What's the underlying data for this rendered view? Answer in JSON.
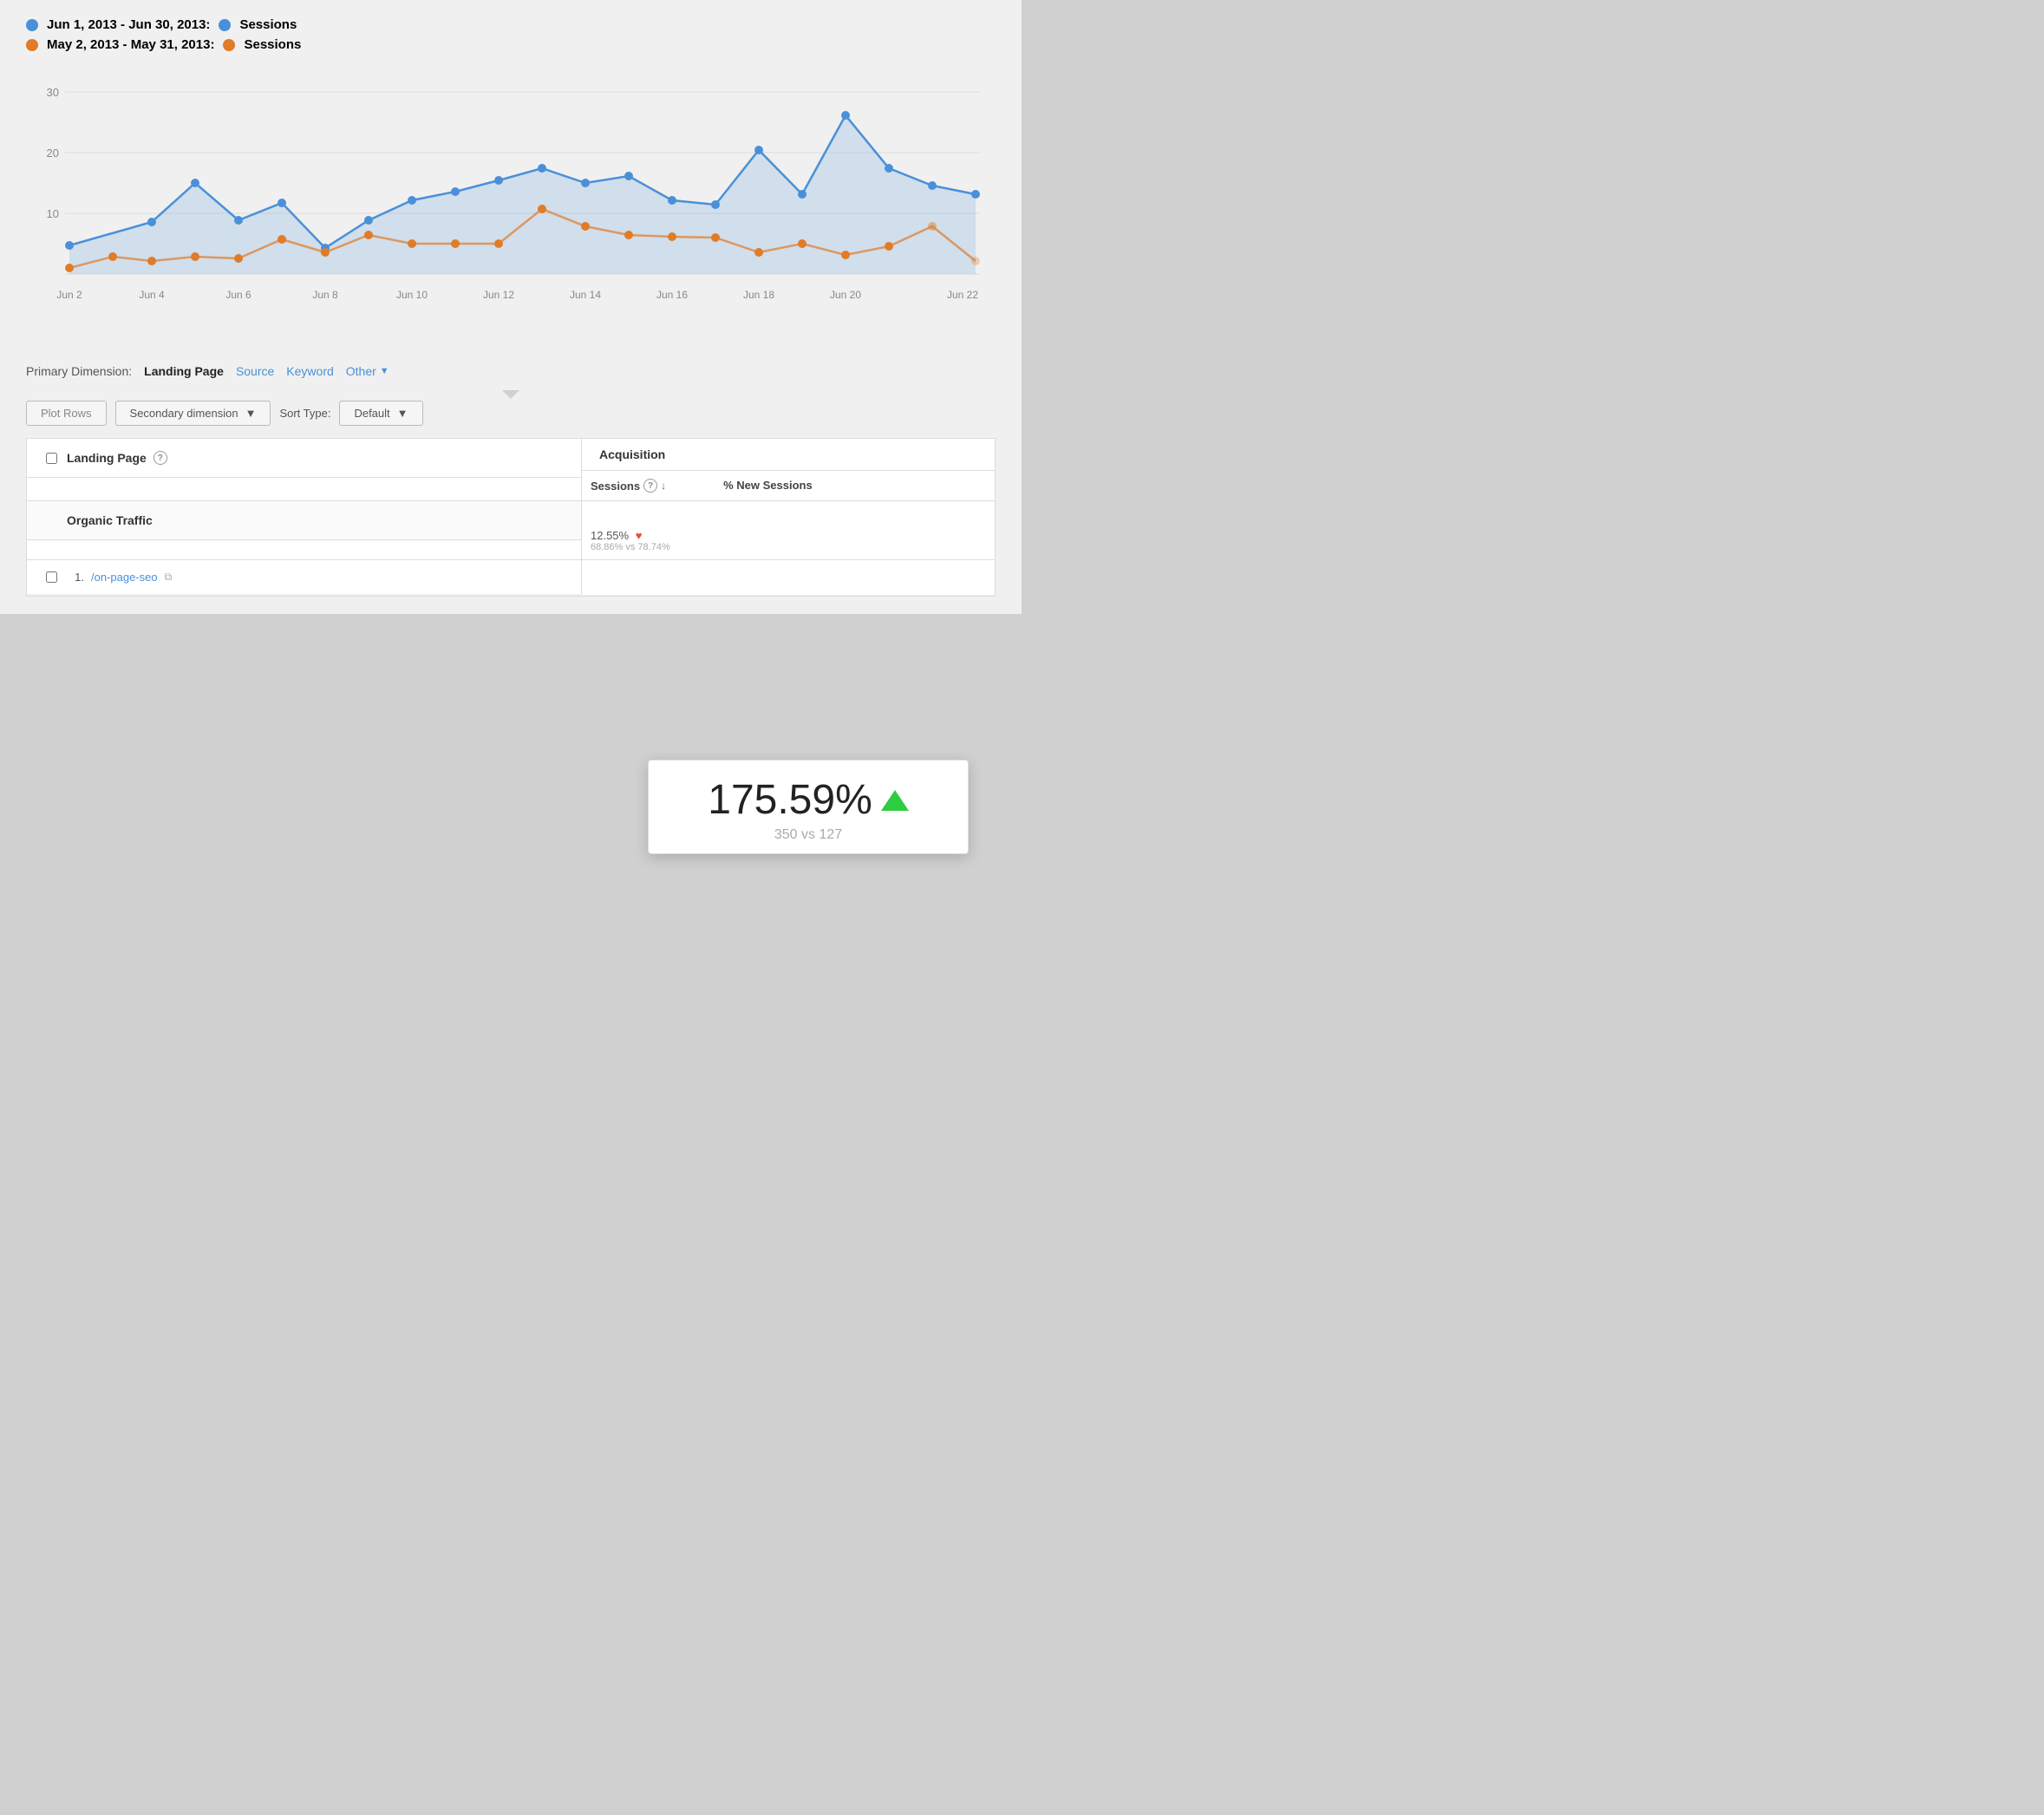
{
  "legend": {
    "date1": {
      "label": "Jun 1, 2013 - Jun 30, 2013:",
      "metric": "Sessions",
      "color": "#4a90d9"
    },
    "date2": {
      "label": "May 2, 2013 - May 31, 2013:",
      "metric": "Sessions",
      "color": "#e07b28"
    }
  },
  "chart": {
    "yAxis": [
      "30",
      "20",
      "10"
    ],
    "xAxis": [
      "Jun 2",
      "Jun 4",
      "Jun 6",
      "Jun 8",
      "Jun 10",
      "Jun 12",
      "Jun 14",
      "Jun 16",
      "Jun 18",
      "Jun 20",
      "Jun 22"
    ]
  },
  "primaryDimension": {
    "label": "Primary Dimension:",
    "active": "Landing Page",
    "links": [
      "Source",
      "Keyword"
    ],
    "other": "Other"
  },
  "controls": {
    "plotRows": "Plot Rows",
    "secondaryDim": "Secondary dimension",
    "sortLabel": "Sort Type:",
    "sortDefault": "Default"
  },
  "table": {
    "acquisitionHeader": "Acquisition",
    "landingPageCol": "Landing Page",
    "sessionsCol": "Sessions",
    "pctNewSessionsCol": "% New Sessions",
    "organicRow": "Organic Traffic",
    "row1": {
      "num": "1.",
      "page": "/on-page-seo"
    }
  },
  "tooltip": {
    "percent": "175.59%",
    "compare": "350 vs 127"
  },
  "rightColData": {
    "pct": "12.55%",
    "compare": "68.86% vs 78.74%"
  }
}
